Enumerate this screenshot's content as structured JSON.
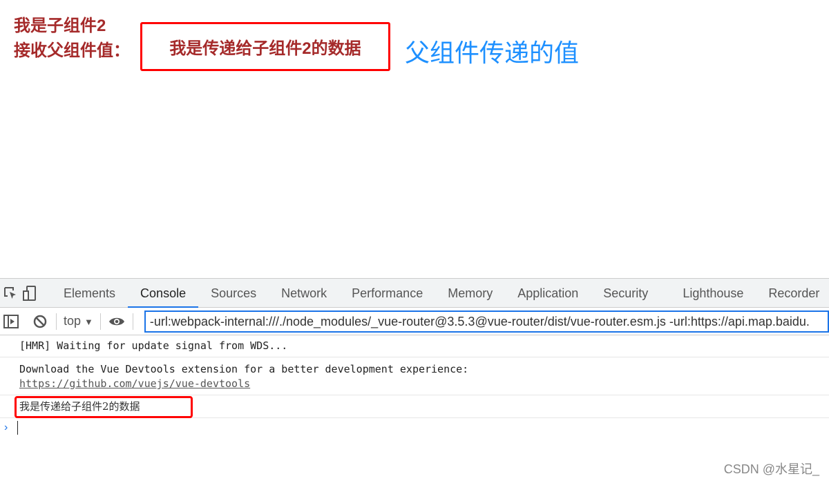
{
  "page": {
    "child_title": "我是子组件2",
    "receive_label": "接收父组件值：",
    "received_value": "我是传递给子组件2的数据",
    "parent_value": "父组件传递的值"
  },
  "devtools": {
    "icons": [
      "inspect-icon",
      "device-toggle-icon"
    ],
    "tabs": [
      {
        "label": "Elements"
      },
      {
        "label": "Console",
        "active": true
      },
      {
        "label": "Sources"
      },
      {
        "label": "Network"
      },
      {
        "label": "Performance"
      },
      {
        "label": "Memory"
      },
      {
        "label": "Application"
      },
      {
        "label": "Security"
      },
      {
        "label": "Lighthouse"
      },
      {
        "label": "Recorder"
      }
    ],
    "toolbar": {
      "context": "top",
      "filter_value": "-url:webpack-internal:///./node_modules/_vue-router@3.5.3@vue-router/dist/vue-router.esm.js -url:https://api.map.baidu."
    },
    "console": {
      "hmr": "[HMR] Waiting for update signal from WDS...",
      "devtools_msg": "Download the Vue Devtools extension for a better development experience:",
      "devtools_link": "https://github.com/vuejs/vue-devtools",
      "log": "我是传递给子组件2的数据",
      "prompt": "›"
    }
  },
  "watermark": "CSDN @水星记_",
  "colors": {
    "child_text": "#a52a2a",
    "parent_text": "#1e90ff",
    "highlight": "#ff0000",
    "accent": "#1a73e8"
  }
}
